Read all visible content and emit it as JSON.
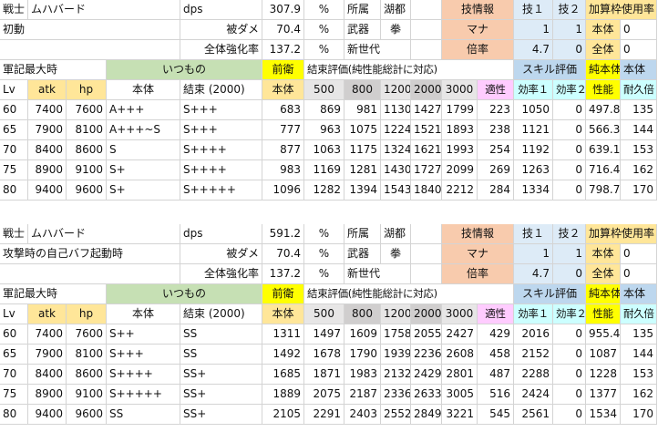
{
  "colors": {
    "salmon": "#f8cbad",
    "blue": "#ddebf7",
    "blue_mid": "#bdd7ee",
    "green": "#c6e0b4",
    "yellow": "#ffff00",
    "gold": "#ffe699",
    "gray": "#e7e6e6",
    "gray_mid": "#d0cece",
    "magenta": "#ffccff",
    "cyan": "#ccffff"
  },
  "blocks": [
    {
      "info_row1": [
        "戦士",
        "ムハバード",
        "dps",
        "307.9",
        "%",
        "所属",
        "湖都",
        "技情報",
        "技１",
        "技２",
        "加算枠使用率"
      ],
      "info_row2": [
        "初動",
        "被ダメ",
        "70.4",
        "%",
        "武器",
        "拳",
        "マナ",
        "1",
        "1",
        "本体",
        "0"
      ],
      "info_row3": [
        "全体強化率",
        "137.2",
        "%",
        "新世代",
        "倍率",
        "4.7",
        "0",
        "全体",
        "0"
      ],
      "group_row": [
        "軍記最大時",
        "いつもの",
        "前衛",
        "結束評価(純性能総計に対応)",
        "スキル評価",
        "純本体",
        "本体"
      ],
      "header_row": [
        "Lv",
        "atk",
        "hp",
        "本体",
        "結束 (2000)",
        "本体",
        "500",
        "800",
        "1200",
        "2000",
        "3000",
        "適性",
        "効率１",
        "効率２",
        "性能",
        "耐久倍"
      ],
      "rows": [
        [
          "60",
          "7400",
          "7600",
          "A+++",
          "S+++",
          "683",
          "869",
          "981",
          "1130",
          "1427",
          "1799",
          "223",
          "1050",
          "0",
          "497.8",
          "135"
        ],
        [
          "65",
          "7900",
          "8100",
          "A+++~S",
          "S+++",
          "777",
          "963",
          "1075",
          "1224",
          "1521",
          "1893",
          "238",
          "1121",
          "0",
          "566.3",
          "144"
        ],
        [
          "70",
          "8400",
          "8600",
          "S",
          "S++++",
          "877",
          "1063",
          "1175",
          "1324",
          "1621",
          "1993",
          "254",
          "1192",
          "0",
          "639.1",
          "153"
        ],
        [
          "75",
          "8900",
          "9100",
          "S+",
          "S++++",
          "983",
          "1169",
          "1281",
          "1430",
          "1727",
          "2099",
          "269",
          "1263",
          "0",
          "716.4",
          "162"
        ],
        [
          "80",
          "9400",
          "9600",
          "S+",
          "S+++++",
          "1096",
          "1282",
          "1394",
          "1543",
          "1840",
          "2212",
          "284",
          "1334",
          "0",
          "798.7",
          "170"
        ]
      ]
    },
    {
      "info_row1": [
        "戦士",
        "ムハバード",
        "dps",
        "591.2",
        "%",
        "所属",
        "湖都",
        "技情報",
        "技１",
        "技２",
        "加算枠使用率"
      ],
      "info_row2": [
        "攻撃時の自己バフ起動時",
        "被ダメ",
        "70.4",
        "%",
        "武器",
        "拳",
        "マナ",
        "1",
        "1",
        "本体",
        "0"
      ],
      "info_row3": [
        "全体強化率",
        "137.2",
        "%",
        "新世代",
        "倍率",
        "4.7",
        "0",
        "全体",
        "0"
      ],
      "group_row": [
        "軍記最大時",
        "いつもの",
        "前衛",
        "結束評価(純性能総計に対応)",
        "スキル評価",
        "純本体",
        "本体"
      ],
      "header_row": [
        "Lv",
        "atk",
        "hp",
        "本体",
        "結束 (2000)",
        "本体",
        "500",
        "800",
        "1200",
        "2000",
        "3000",
        "適性",
        "効率１",
        "効率２",
        "性能",
        "耐久倍"
      ],
      "rows": [
        [
          "60",
          "7400",
          "7600",
          "S++",
          "SS",
          "1311",
          "1497",
          "1609",
          "1758",
          "2055",
          "2427",
          "429",
          "2016",
          "0",
          "955.4",
          "135"
        ],
        [
          "65",
          "7900",
          "8100",
          "S+++",
          "SS",
          "1492",
          "1678",
          "1790",
          "1939",
          "2236",
          "2608",
          "458",
          "2152",
          "0",
          "1087",
          "144"
        ],
        [
          "70",
          "8400",
          "8600",
          "S++++",
          "SS+",
          "1685",
          "1871",
          "1983",
          "2132",
          "2429",
          "2801",
          "487",
          "2288",
          "0",
          "1228",
          "153"
        ],
        [
          "75",
          "8900",
          "9100",
          "S+++++",
          "SS+",
          "1889",
          "2075",
          "2187",
          "2336",
          "2633",
          "3005",
          "516",
          "2424",
          "0",
          "1377",
          "162"
        ],
        [
          "80",
          "9400",
          "9600",
          "SS",
          "SS+",
          "2105",
          "2291",
          "2403",
          "2552",
          "2849",
          "3221",
          "545",
          "2561",
          "0",
          "1534",
          "170"
        ]
      ]
    }
  ]
}
